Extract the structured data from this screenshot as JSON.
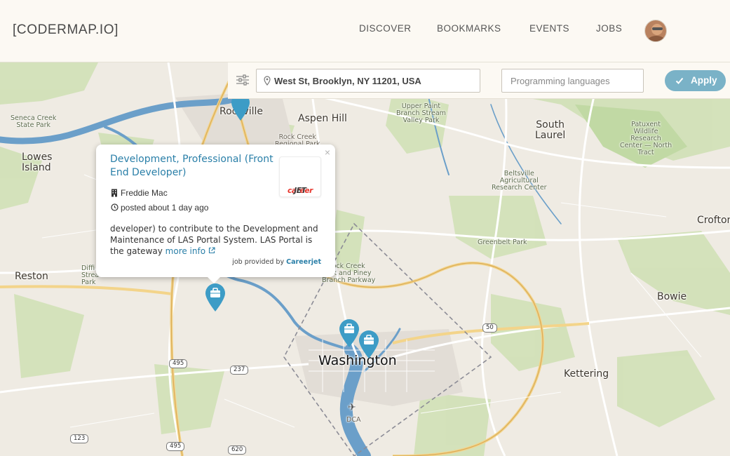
{
  "header": {
    "logo": "[CODERMAP.IO]",
    "nav": [
      {
        "label": "DISCOVER"
      },
      {
        "label": "BOOKMARKS"
      },
      {
        "label": "EVENTS"
      },
      {
        "label": "JOBS"
      }
    ],
    "avatar_icon": "user-avatar"
  },
  "filters": {
    "filter_icon": "sliders-icon",
    "location_icon": "map-pin-icon",
    "location_value": "West St, Brooklyn, NY 11201, USA",
    "languages_placeholder": "Programming languages",
    "apply_label": "Apply",
    "apply_icon": "checkmark-icon",
    "accent": "#7ab2c7"
  },
  "map": {
    "labels": {
      "rockville": "Rockville",
      "aspen_hill": "Aspen Hill",
      "seneca": "Seneca Creek\nState Park",
      "lowes_island": "Lowes\nIsland",
      "upper_paint": "Upper Paint\nBranch Stream\nValley Park",
      "south_laurel": "South\nLaurel",
      "patuxent": "Patuxent\nWildlife\nResearch\nCenter — North\nTract",
      "rock_creek_regional": "Rock Creek\nRegional Park",
      "beltsville": "Beltsville\nAgricultural\nResearch Center",
      "crofton": "Crofton",
      "greenbelt": "Greenbelt Park",
      "reston": "Reston",
      "difficult_run": "Diffi\nStrea\nPark",
      "rock_creek_piney": "ock Creek\nark and Piney\nBranch Parkway",
      "bowie": "Bowie",
      "washington": "Washington",
      "kettering": "Kettering",
      "dca": "DCA"
    },
    "shields": {
      "i495_a": "495",
      "r237": "237",
      "r50": "50",
      "r123": "123",
      "i495_b": "495",
      "r620": "620"
    },
    "marker_color": "#3d9cc6",
    "marker_icon": "briefcase-icon"
  },
  "popup": {
    "title": "Development, Professional (Front End Developer)",
    "company_logo_part1": "career",
    "company_logo_part2": "JET",
    "company_icon": "building-icon",
    "company": "Freddie Mac",
    "time_icon": "clock-icon",
    "posted": "posted about 1 day ago",
    "description": "developer) to contribute to the Development and Maintenance of LAS Portal System. LAS Portal is the gateway ",
    "more_info": "more info",
    "external_icon": "external-link-icon",
    "provider_prefix": "job provided by ",
    "provider_name": "Careerjet",
    "close": "×"
  }
}
